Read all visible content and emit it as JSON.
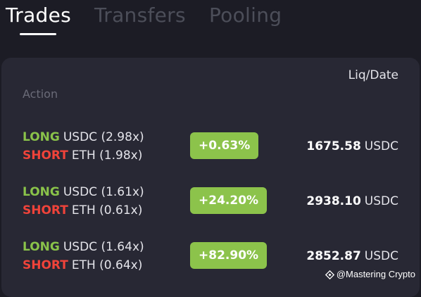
{
  "tabs": [
    {
      "label": "Trades",
      "active": true
    },
    {
      "label": "Transfers",
      "active": false
    },
    {
      "label": "Pooling",
      "active": false
    }
  ],
  "table": {
    "columns": {
      "action": "Action",
      "liq_date": "Liq/Date"
    },
    "rows": [
      {
        "long": {
          "side": "LONG",
          "asset": "USDC (2.98x)"
        },
        "short": {
          "side": "SHORT",
          "asset": "ETH (1.98x)"
        },
        "pnl": "+0.63%",
        "liq_value": "1675.58",
        "liq_unit": "USDC"
      },
      {
        "long": {
          "side": "LONG",
          "asset": "USDC (1.61x)"
        },
        "short": {
          "side": "SHORT",
          "asset": "ETH (0.61x)"
        },
        "pnl": "+24.20%",
        "liq_value": "2938.10",
        "liq_unit": "USDC"
      },
      {
        "long": {
          "side": "LONG",
          "asset": "USDC (1.64x)"
        },
        "short": {
          "side": "SHORT",
          "asset": "ETH (0.64x)"
        },
        "pnl": "+82.90%",
        "liq_value": "2852.87",
        "liq_unit": "USDC"
      }
    ]
  },
  "watermark": {
    "icon": "binance-square-icon",
    "text": "@Mastering Crypto"
  },
  "colors": {
    "background": "#1c1c25",
    "panel": "#282834",
    "long": "#8ac34a",
    "short": "#f0433a",
    "pnl_badge": "#8cc34b",
    "tab_inactive": "#4c4e59"
  }
}
